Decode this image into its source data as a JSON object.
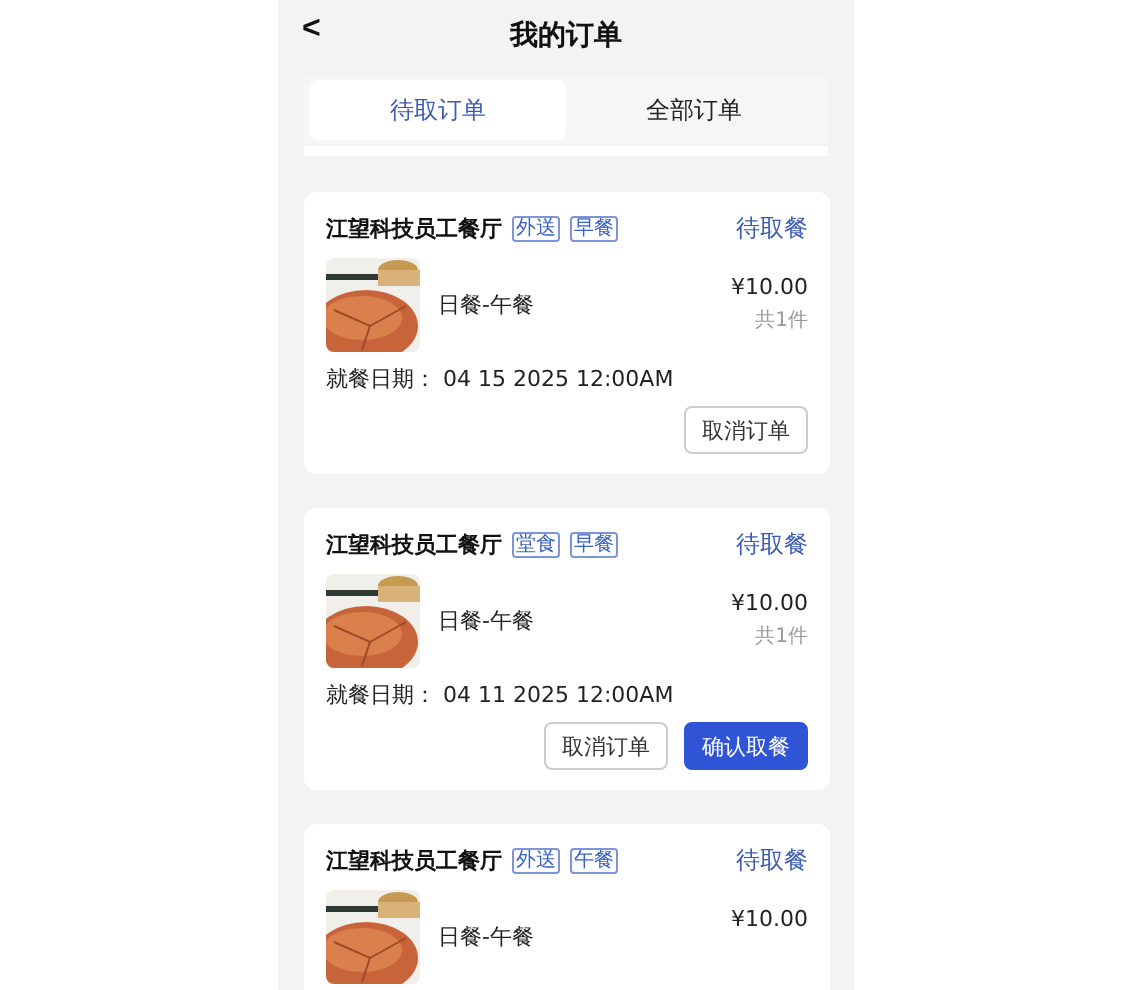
{
  "header": {
    "back": "<",
    "title": "我的订单"
  },
  "tabs": [
    {
      "label": "待取订单",
      "selected": true
    },
    {
      "label": "全部订单",
      "selected": false
    }
  ],
  "orders": [
    {
      "restaurant": "江望科技员工餐厅",
      "tags": [
        "外送",
        "早餐"
      ],
      "status": "待取餐",
      "item": "日餐-午餐",
      "price": "¥10.00",
      "count": "共1件",
      "date_label": "就餐日期：",
      "date": "04 15 2025 12:00AM",
      "buttons": [
        {
          "label": "取消订单",
          "kind": "outline"
        }
      ]
    },
    {
      "restaurant": "江望科技员工餐厅",
      "tags": [
        "堂食",
        "早餐"
      ],
      "status": "待取餐",
      "item": "日餐-午餐",
      "price": "¥10.00",
      "count": "共1件",
      "date_label": "就餐日期：",
      "date": "04 11 2025 12:00AM",
      "buttons": [
        {
          "label": "取消订单",
          "kind": "outline"
        },
        {
          "label": "确认取餐",
          "kind": "primary"
        }
      ]
    },
    {
      "restaurant": "江望科技员工餐厅",
      "tags": [
        "外送",
        "午餐"
      ],
      "status": "待取餐",
      "item": "日餐-午餐",
      "price": "¥10.00"
    }
  ]
}
